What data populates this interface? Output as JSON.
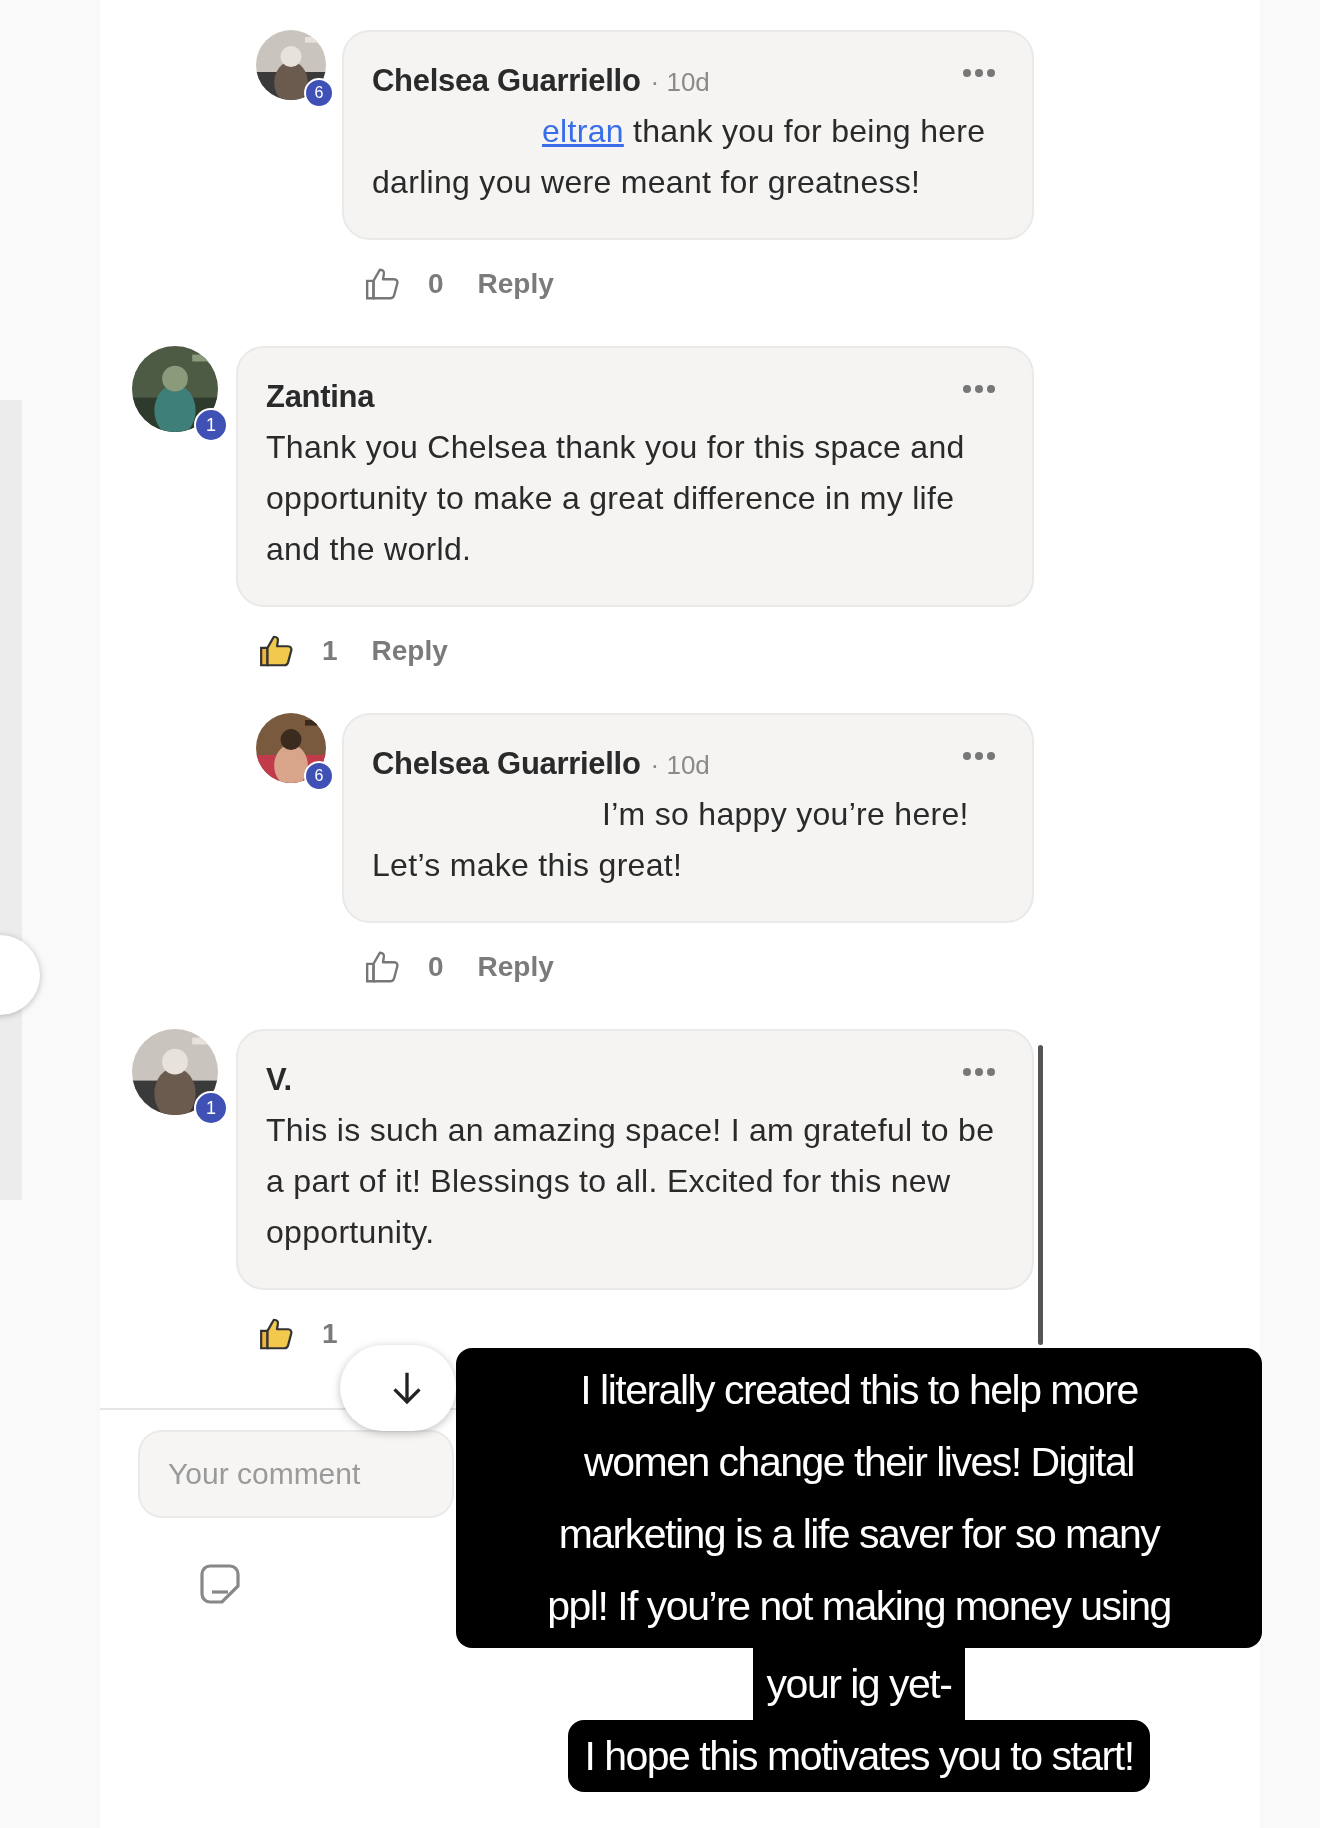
{
  "leading_replies": [
    {
      "author": "Chelsea Guarriello",
      "time": "· 10d",
      "badge": "6",
      "mention": "eltran",
      "text": " thank you for being here darling you were meant for greatness!",
      "liked": false,
      "likes": "0",
      "reply": "Reply"
    }
  ],
  "comments": [
    {
      "author": "Zantina",
      "badge": "1",
      "text": "Thank you Chelsea thank you for this space and opportunity to make a great difference in my life and the world.",
      "liked": true,
      "likes": "1",
      "reply": "Reply",
      "children": [
        {
          "author": "Chelsea Guarriello",
          "time": "· 10d",
          "badge": "6",
          "text": "I’m so happy you’re here! Let’s make this great!",
          "liked": false,
          "likes": "0",
          "reply": "Reply"
        }
      ]
    },
    {
      "author": "V.",
      "badge": "1",
      "text": "This is such an amazing space! I am grateful to be a part of it! Blessings to all. Excited for this new opportunity.",
      "liked": true,
      "likes": "1"
    }
  ],
  "comment_field": {
    "placeholder": "Your comment"
  },
  "caption": {
    "blocks": [
      [
        "I literally created this to help more",
        "women change their lives! Digital",
        "marketing is a life saver for so many",
        "ppl! If you’re not making money using"
      ],
      [
        "your ig yet-"
      ],
      [
        "I hope this motivates you to start!"
      ]
    ]
  }
}
